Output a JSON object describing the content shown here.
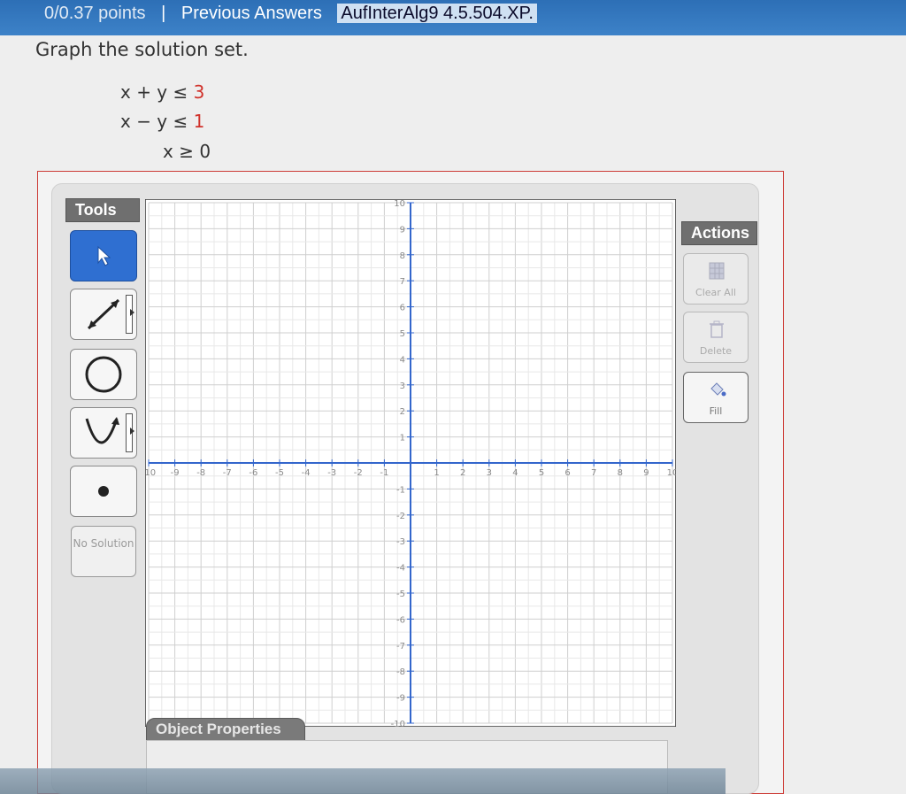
{
  "header": {
    "points": "0/0.37 points",
    "separator": "|",
    "previous_answers": "Previous Answers",
    "code": "AufInterAlg9 4.5.504.XP."
  },
  "question": {
    "prompt": "Graph the solution set.",
    "inequalities": [
      {
        "lhs": "x + y ≤ ",
        "rhs": "3",
        "rhs_color": "red"
      },
      {
        "lhs": "x − y ≤ ",
        "rhs": "1",
        "rhs_color": "red"
      },
      {
        "lhs": "x ≥ ",
        "rhs": "0",
        "rhs_color": "black"
      }
    ]
  },
  "tools": {
    "label": "Tools",
    "items": [
      {
        "name": "pointer",
        "icon": "arrow-cursor-icon",
        "active": true
      },
      {
        "name": "line",
        "icon": "line-segment-icon",
        "active": false
      },
      {
        "name": "circle",
        "icon": "circle-icon",
        "active": false
      },
      {
        "name": "parabola",
        "icon": "parabola-icon",
        "active": false
      },
      {
        "name": "point",
        "icon": "dot-icon",
        "active": false
      }
    ],
    "no_solution_label": "No Solution"
  },
  "actions": {
    "label": "Actions",
    "items": [
      {
        "label": "Clear All",
        "icon": "clear-all-icon",
        "enabled": false
      },
      {
        "label": "Delete",
        "icon": "trash-icon",
        "enabled": false
      },
      {
        "label": "Fill",
        "icon": "fill-icon",
        "enabled": true
      }
    ]
  },
  "graph": {
    "x_range": [
      -10,
      10
    ],
    "y_range": [
      -10,
      10
    ],
    "x_tick_labels": [
      "-10",
      "-9",
      "-8",
      "-7",
      "-6",
      "-5",
      "-4",
      "-3",
      "-2",
      "-1",
      "1",
      "2",
      "3",
      "4",
      "5",
      "6",
      "7",
      "8",
      "9",
      "10"
    ],
    "y_tick_labels": [
      "10",
      "9",
      "8",
      "7",
      "6",
      "5",
      "4",
      "3",
      "2",
      "1",
      "-1",
      "-2",
      "-3",
      "-4",
      "-5",
      "-6",
      "-7",
      "-8",
      "-9",
      "-10"
    ],
    "grid": true,
    "axis_color": "#3366cc"
  },
  "object_properties": {
    "label": "Object Properties"
  }
}
